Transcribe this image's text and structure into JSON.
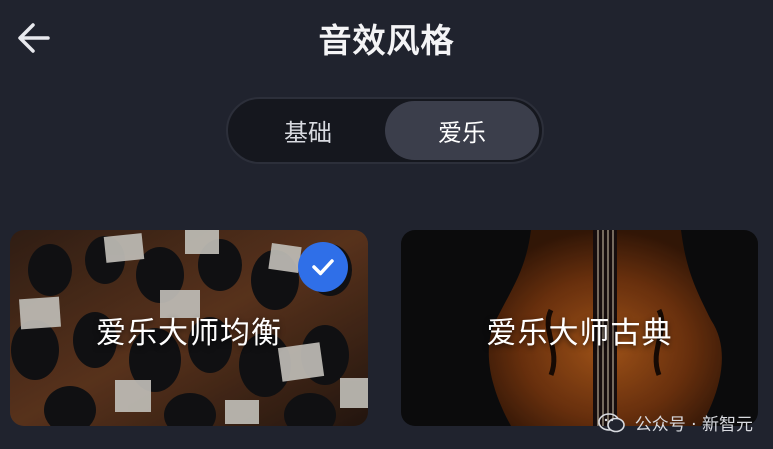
{
  "header": {
    "title": "音效风格",
    "back_icon": "arrow-left-icon"
  },
  "segment": {
    "tabs": [
      {
        "label": "基础",
        "active": false
      },
      {
        "label": "爱乐",
        "active": true
      }
    ]
  },
  "cards": [
    {
      "label": "爱乐大师均衡",
      "selected": true,
      "image": "orchestra-photo"
    },
    {
      "label": "爱乐大师古典",
      "selected": false,
      "image": "cello-photo"
    }
  ],
  "watermark": {
    "text": "公众号 · 新智元",
    "icon": "wechat-icon"
  },
  "colors": {
    "background": "#20232e",
    "accent": "#2f6fe8",
    "tab_active": "#3b3e4b"
  }
}
